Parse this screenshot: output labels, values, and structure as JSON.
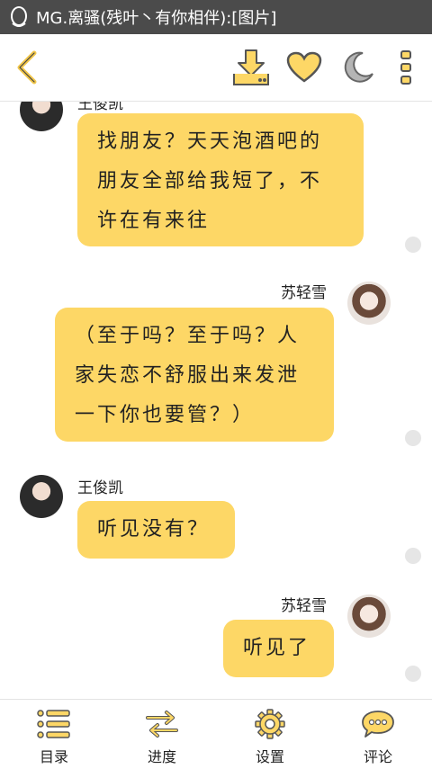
{
  "statusbar": {
    "title": "MG.离骚(残叶丶有你相伴):[图片]"
  },
  "topbar": {
    "icons": [
      "back-chevron-icon",
      "download-icon",
      "heart-icon",
      "moon-icon",
      "more-vertical-icon"
    ],
    "accent": "#fdd766"
  },
  "messages": [
    {
      "sender": "王俊凯",
      "side": "left",
      "text": "找朋友？天天泡酒吧的朋友全部给我短了，不许在有来往"
    },
    {
      "sender": "苏轻雪",
      "side": "right",
      "text": "（至于吗？至于吗？人家失恋不舒服出来发泄一下你也要管？）"
    },
    {
      "sender": "王俊凯",
      "side": "left",
      "text": "听见没有？"
    },
    {
      "sender": "苏轻雪",
      "side": "right",
      "text": "听见了"
    }
  ],
  "bottom_nav": [
    {
      "label": "目录",
      "icon": "list-icon"
    },
    {
      "label": "进度",
      "icon": "swap-arrows-icon"
    },
    {
      "label": "设置",
      "icon": "gear-icon"
    },
    {
      "label": "评论",
      "icon": "comment-icon"
    }
  ],
  "colors": {
    "bubble": "#fdd766",
    "statusbar": "#4b4b4b",
    "icon_stroke": "#555555"
  }
}
